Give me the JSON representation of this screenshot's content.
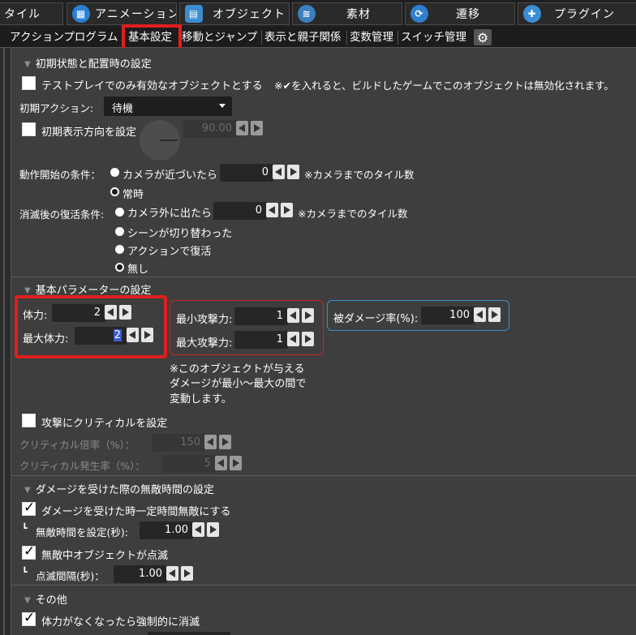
{
  "top_tabs": [
    {
      "label": "タイル",
      "icon": ""
    },
    {
      "label": "アニメーション",
      "icon": "animation-icon"
    },
    {
      "label": "オブジェクト",
      "icon": "object-icon"
    },
    {
      "label": "素材",
      "icon": "material-icon"
    },
    {
      "label": "遷移",
      "icon": "transition-icon"
    },
    {
      "label": "プラグイン",
      "icon": "plugin-icon"
    }
  ],
  "sub_tabs": [
    "アクションプログラム",
    "基本設定",
    "移動とジャンプ",
    "表示と親子関係",
    "変数管理",
    "スイッチ管理"
  ],
  "sections": {
    "initial": {
      "header": "初期状態と配置時の設定",
      "testplay_only_label": "テストプレイでのみ有効なオブジェクトとする",
      "testplay_note": "※✔を入れると、ビルドしたゲームでこのオブジェクトは無効化されます。",
      "initial_action_label": "初期アクション:",
      "initial_action_value": "待機",
      "initial_direction_label": "初期表示方向を設定",
      "initial_direction_value": "90.00",
      "start_condition_label": "動作開始の条件：",
      "camera_near_label": "カメラが近づいたら",
      "camera_near_value": "0",
      "camera_tiles_note": "※カメラまでのタイル数",
      "always_label": "常時",
      "revive_label": "消滅後の復活条件:",
      "camera_out_label": "カメラ外に出たら",
      "camera_out_value": "0",
      "camera_out_note": "※カメラまでのタイル数",
      "scene_switch_label": "シーンが切り替わった",
      "action_revive_label": "アクションで復活",
      "none_label": "無し"
    },
    "params": {
      "header": "基本パラメーターの設定",
      "hp_label": "体力:",
      "hp_value": "2",
      "max_hp_label": "最大体力:",
      "max_hp_value": "2",
      "min_atk_label": "最小攻撃力:",
      "min_atk_value": "1",
      "max_atk_label": "最大攻撃力:",
      "max_atk_value": "1",
      "damage_rate_label": "被ダメージ率(%):",
      "damage_rate_value": "100",
      "damage_note_1": "※このオブジェクトが与える",
      "damage_note_2": "ダメージが最小～最大の間で",
      "damage_note_3": "変動します。",
      "critical_label": "攻撃にクリティカルを設定",
      "critical_mult_label": "クリティカル倍率（%）：",
      "critical_mult_value": "150",
      "critical_rate_label": "クリティカル発生率（%）：",
      "critical_rate_value": "5"
    },
    "invincible": {
      "header": "ダメージを受けた際の無敵時間の設定",
      "invincible_label": "ダメージを受けた時一定時間無敵にする",
      "invincible_time_label": "無敵時間を設定(秒):",
      "invincible_time_value": "1.00",
      "blink_label": "無敵中オブジェクトが点滅",
      "blink_interval_label": "点滅間隔(秒)：",
      "blink_interval_value": "1.00",
      "sub_prefix": "┗"
    },
    "other": {
      "header": "その他",
      "force_vanish_label": "体力がなくなったら強制的に消滅"
    }
  },
  "colors": {
    "highlight_red": "#e01e1e",
    "group_red": "#c62828",
    "group_blue": "#3a8fc9",
    "selection_blue": "#3d5bd6"
  }
}
